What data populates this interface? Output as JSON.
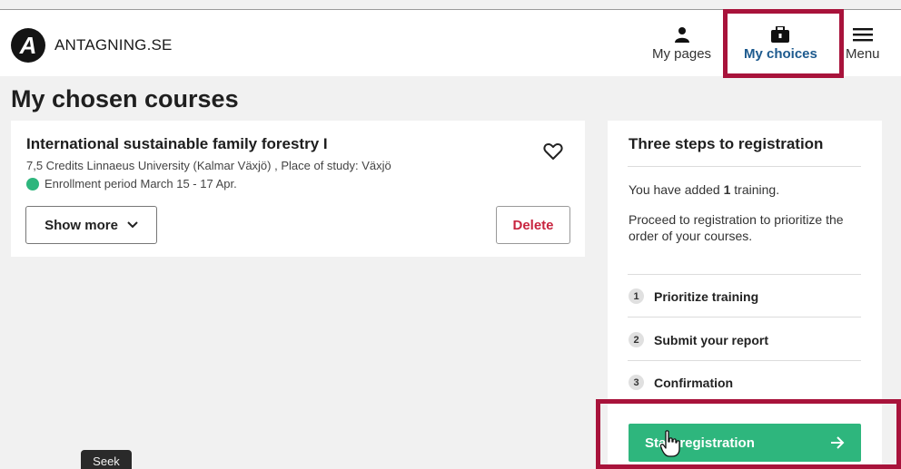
{
  "header": {
    "logo_letter": "A",
    "logo_text": "ANTAGNING.SE",
    "nav": {
      "my_pages": "My pages",
      "my_choices": "My choices",
      "menu": "Menu"
    }
  },
  "page_title": "My chosen courses",
  "course": {
    "title": "International sustainable family forestry I",
    "meta": "7,5 Credits Linnaeus University (Kalmar Växjö) , Place of study: Växjö",
    "enrollment": "Enrollment period March 15 - 17 Apr.",
    "show_more_label": "Show more",
    "delete_label": "Delete",
    "status_color": "#2eb67d"
  },
  "registration": {
    "title": "Three steps to registration",
    "added_prefix": "You have added ",
    "added_count": "1",
    "added_suffix": " training.",
    "proceed_text": "Proceed to registration to prioritize the order of your courses.",
    "steps": [
      {
        "num": "1",
        "label": "Prioritize training"
      },
      {
        "num": "2",
        "label": "Submit your report"
      },
      {
        "num": "3",
        "label": "Confirmation"
      }
    ],
    "start_label": "Start registration",
    "accent_color": "#2eb67d"
  },
  "overlay": {
    "seek_label": "Seek",
    "highlight_color": "#a8133b"
  },
  "icons": {
    "logo": "logo-a-icon",
    "my_pages": "person-icon",
    "my_choices": "briefcase-icon",
    "menu": "hamburger-icon",
    "favorite": "heart-icon",
    "show_more": "chevron-down-icon",
    "start": "arrow-right-icon",
    "cursor": "hand-pointer-icon"
  }
}
